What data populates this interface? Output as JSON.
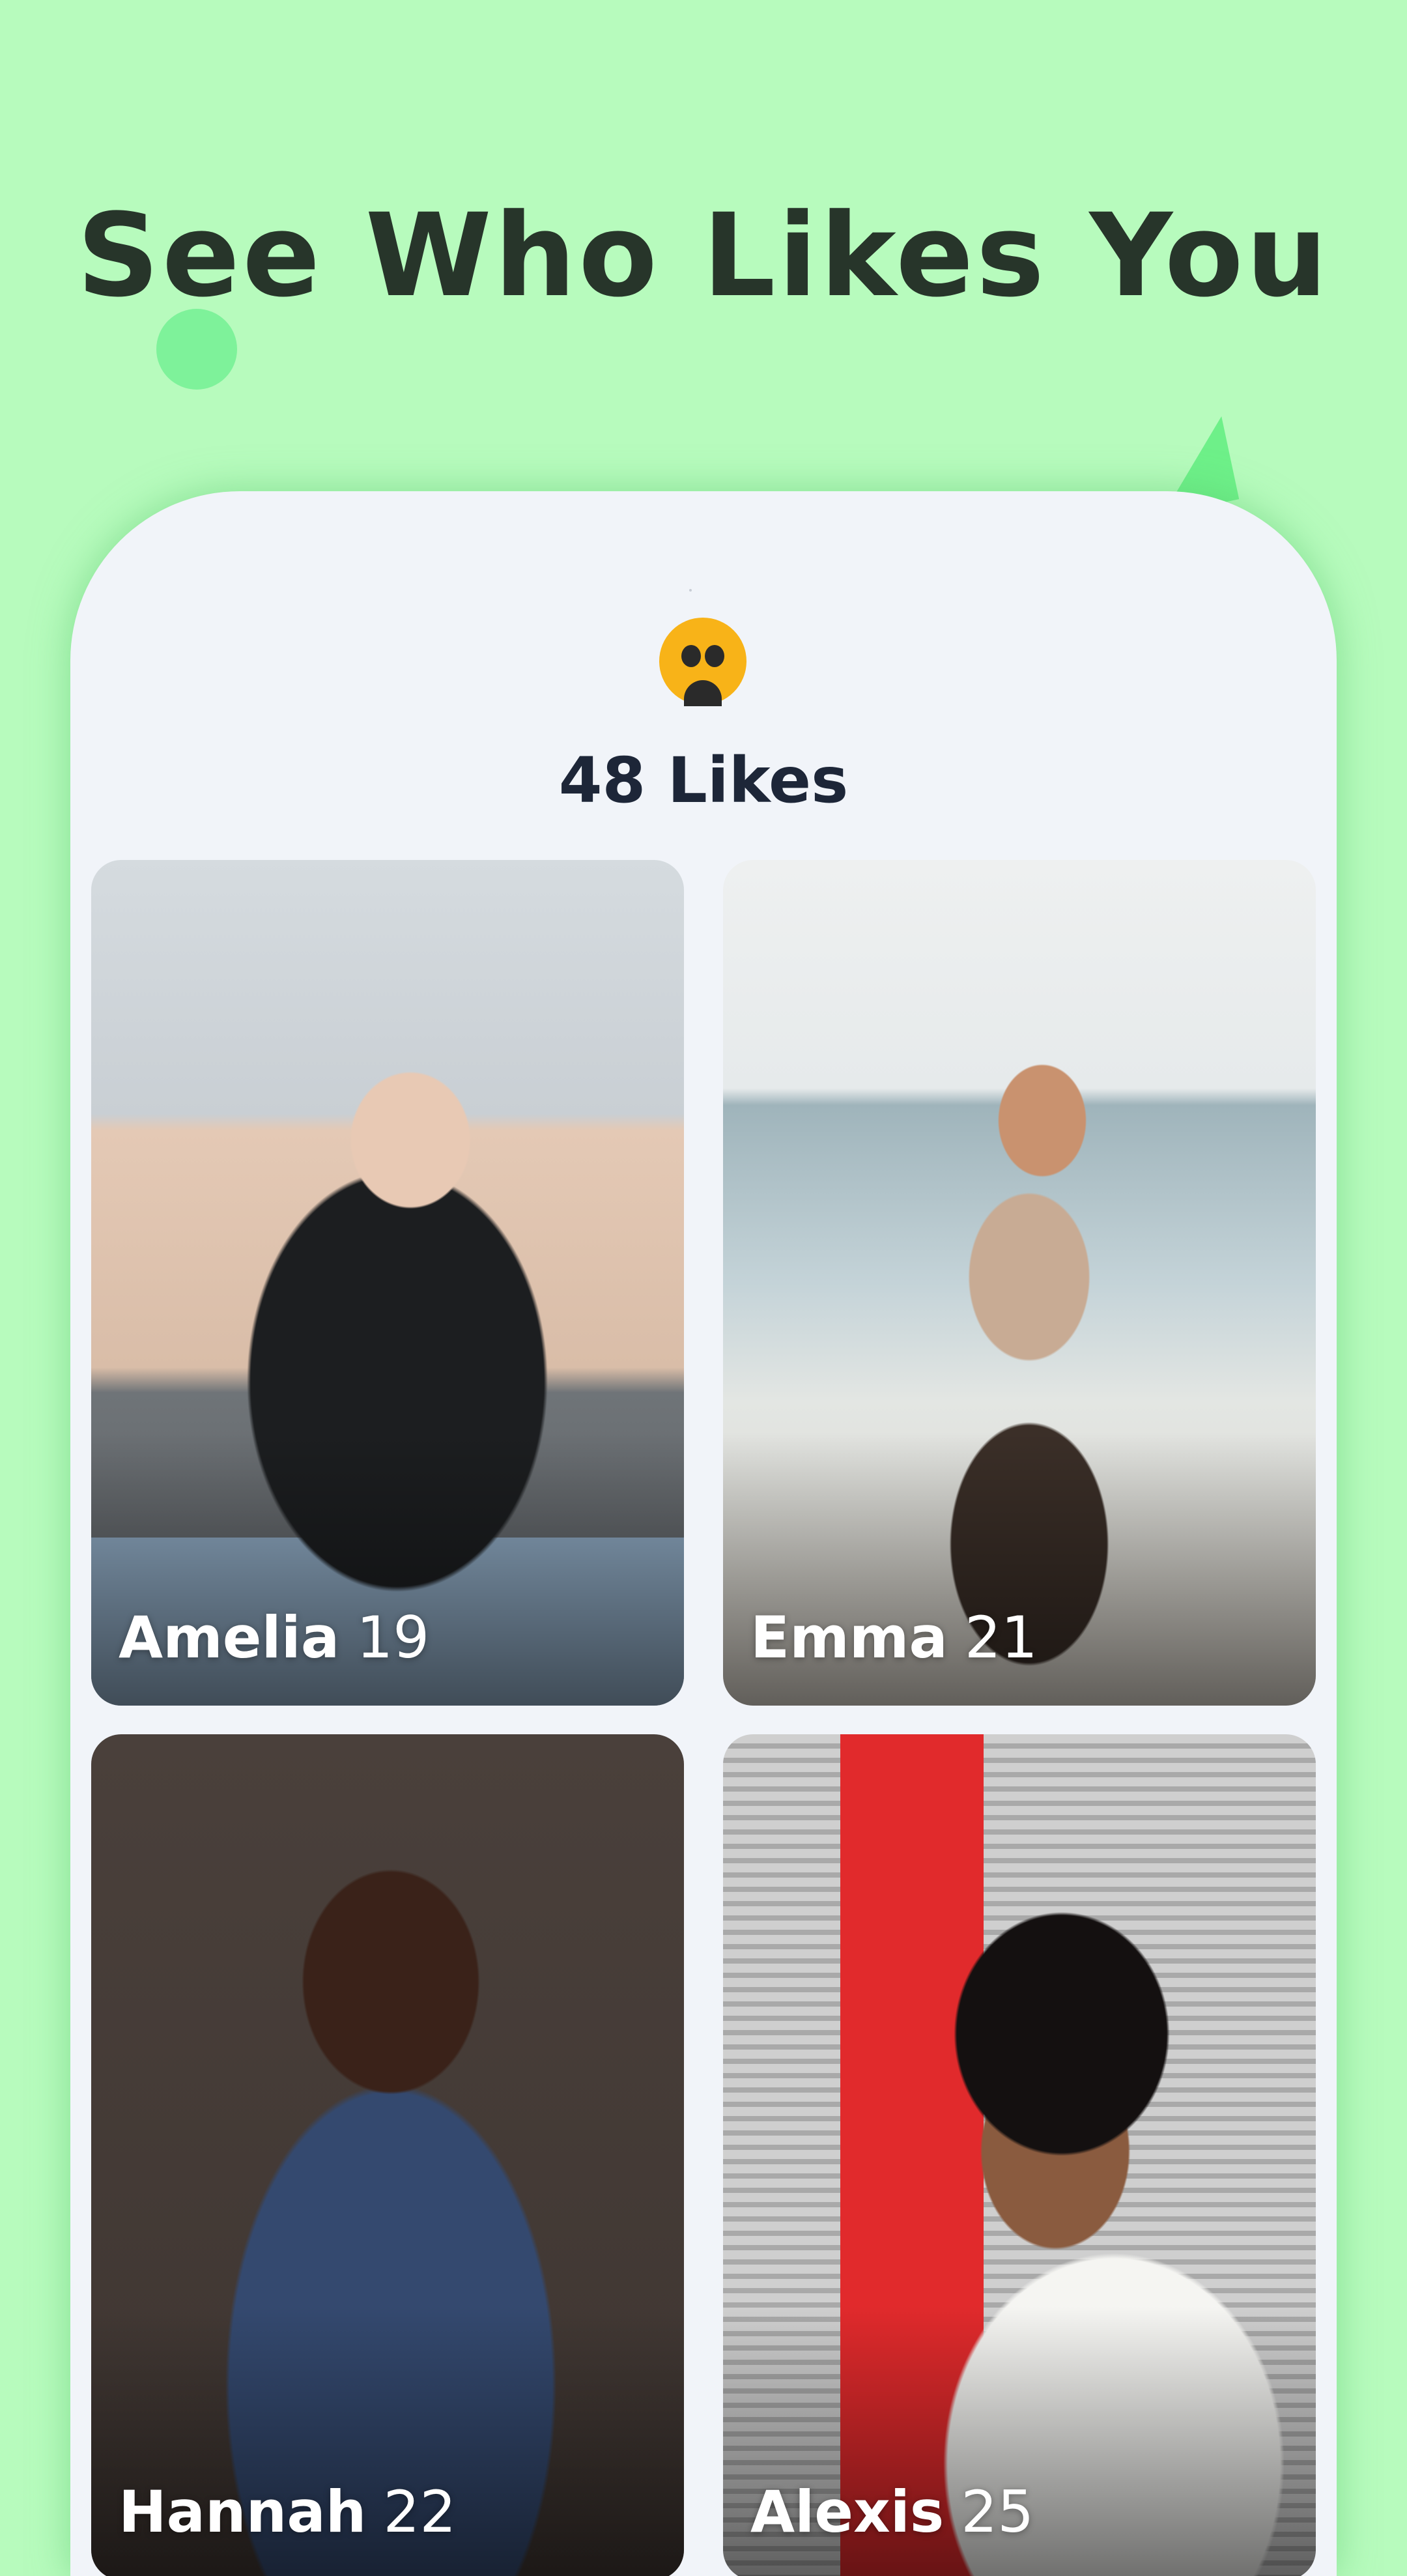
{
  "headline": "See Who Likes You",
  "likes": {
    "count_label": "48 Likes"
  },
  "profiles": [
    {
      "name": "Amelia",
      "age": "19"
    },
    {
      "name": "Emma",
      "age": "21"
    },
    {
      "name": "Hannah",
      "age": "22"
    },
    {
      "name": "Alexis",
      "age": "25"
    }
  ],
  "colors": {
    "background": "#b7fbbd",
    "panel": "#f1f4f9",
    "headline_text": "#27352a",
    "emoji": "#f8b318",
    "accent_green": "#7ef29a"
  },
  "icons": {
    "likes_emoji": "face-with-open-mouth-icon"
  }
}
